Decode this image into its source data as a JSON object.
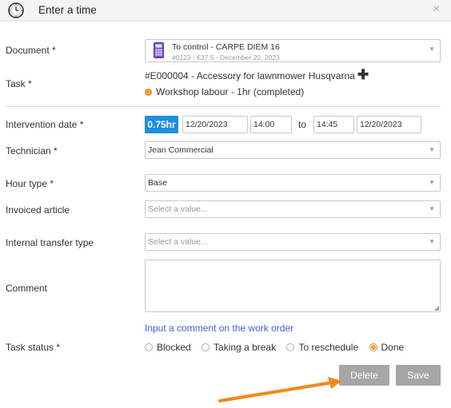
{
  "header": {
    "title": "Enter a time",
    "icon": "clock-icon",
    "close_icon": "close-icon",
    "close_glyph": "×"
  },
  "form": {
    "document": {
      "label": "Document *",
      "value": "To control - CARPE DIEM 16",
      "sub": "#0123 - €37.5 - December 20, 2023",
      "icon": "calculator-icon"
    },
    "task": {
      "label": "Task *",
      "value": "#E000004 - Accessory for lawnmower Husqvarna",
      "sub": "Workshop labour - 1hr (completed)",
      "add_glyph": "✚"
    },
    "intervention_date": {
      "label": "Intervention date *",
      "duration": "0.75hr",
      "start_date": "12/20/2023",
      "start_time": "14:00",
      "to_label": "to",
      "end_time": "14:45",
      "end_date": "12/20/2023"
    },
    "technician": {
      "label": "Technician *",
      "value": "Jean Commercial"
    },
    "hour_type": {
      "label": "Hour type *",
      "value": "Base"
    },
    "invoiced_article": {
      "label": "Invoiced article",
      "placeholder": "Select a value..."
    },
    "internal_transfer_type": {
      "label": "Internal transfer type",
      "placeholder": "Select a value..."
    },
    "comment": {
      "label": "Comment",
      "value": ""
    },
    "comment_link": "Input a comment on the work order",
    "task_status": {
      "label": "Task status *",
      "options": [
        "Blocked",
        "Taking a break",
        "To reschedule",
        "Done"
      ],
      "selected": "Done"
    }
  },
  "buttons": {
    "delete": "Delete",
    "save": "Save"
  },
  "colors": {
    "accent_blue": "#1c8fe0",
    "link": "#4a57d8",
    "orange": "#f0a040",
    "arrow": "#f08a1a",
    "button_gray": "#a6a6a6"
  },
  "caret_glyph": "▼",
  "resize_glyph": "◢"
}
